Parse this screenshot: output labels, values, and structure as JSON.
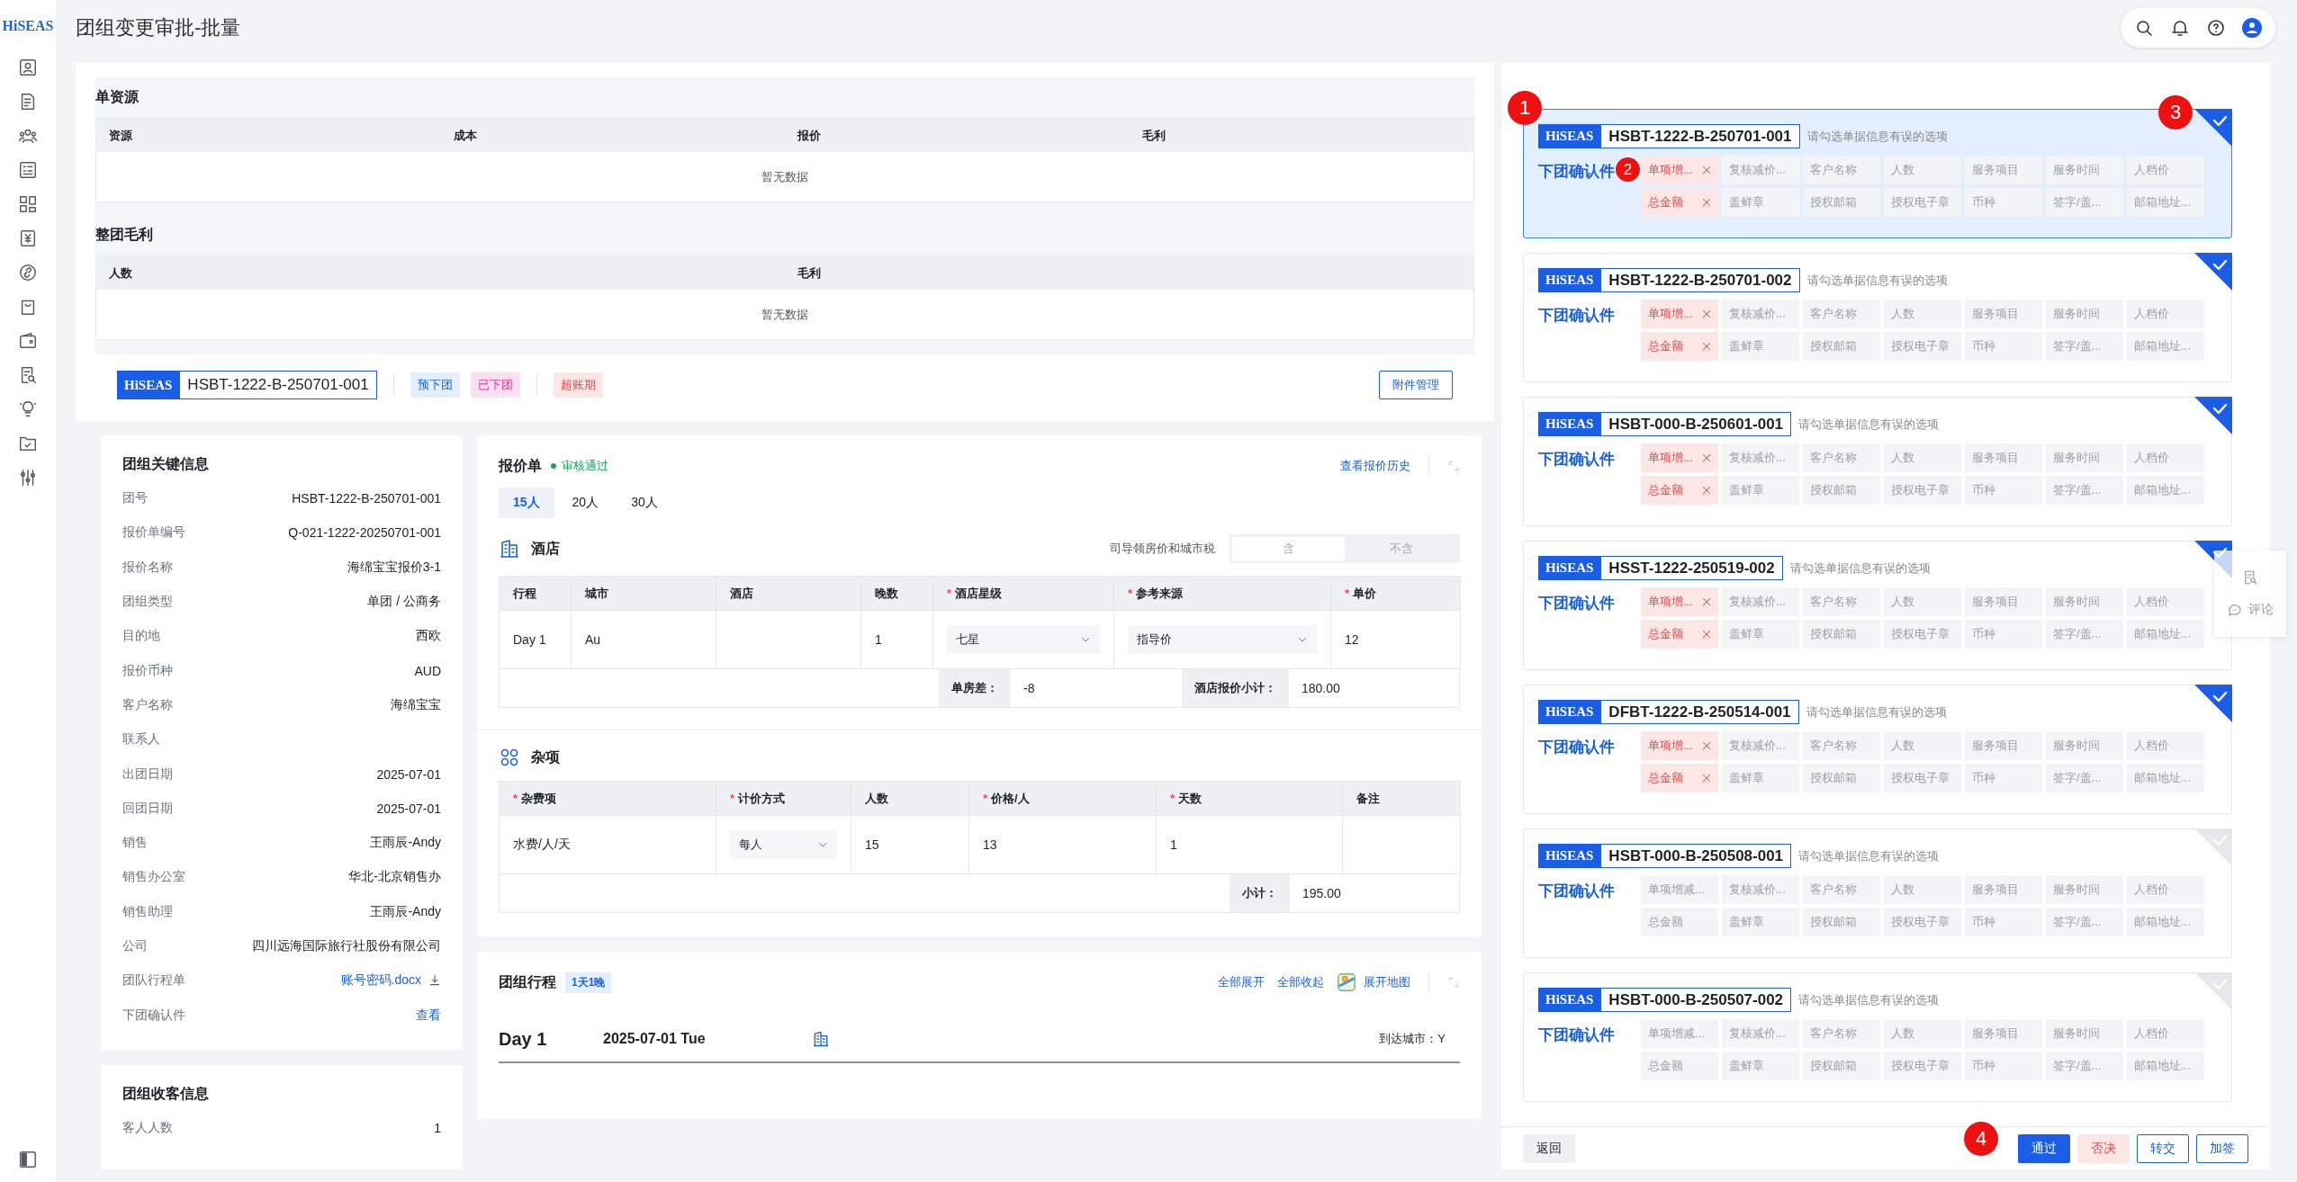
{
  "sidebar": {
    "logo": "HiSEAS"
  },
  "header": {
    "title": "团组变更审批-批量"
  },
  "single_resource": {
    "title": "单资源",
    "columns": [
      "资源",
      "成本",
      "报价",
      "毛利"
    ],
    "empty_text": "暂无数据"
  },
  "group_margin": {
    "title": "整团毛利",
    "columns": [
      "人数",
      "毛利"
    ],
    "empty_text": "暂无数据"
  },
  "group_bar": {
    "logo": "HiSEAS",
    "code": "HSBT-1222-B-250701-001",
    "status_tags": [
      {
        "text": "预下团",
        "kind": "pre"
      },
      {
        "text": "已下团",
        "kind": "done"
      }
    ],
    "alert_tags": [
      {
        "text": "超账期",
        "kind": "overdue"
      }
    ],
    "button": "附件管理"
  },
  "key_info": {
    "title": "团组关键信息",
    "rows": [
      {
        "label": "团号",
        "value": "HSBT-1222-B-250701-001",
        "kind": "text"
      },
      {
        "label": "报价单编号",
        "value": "Q-021-1222-20250701-001",
        "kind": "text"
      },
      {
        "label": "报价名称",
        "value": "海绵宝宝报价3-1",
        "kind": "text"
      },
      {
        "label": "团组类型",
        "value": "单团 / 公商务",
        "kind": "text"
      },
      {
        "label": "目的地",
        "value": "西欧",
        "kind": "text"
      },
      {
        "label": "报价币种",
        "value": "AUD",
        "kind": "text"
      },
      {
        "label": "客户名称",
        "value": "海绵宝宝",
        "kind": "text"
      },
      {
        "label": "联系人",
        "kind": "text"
      },
      {
        "label": "出团日期",
        "value": "2025-07-01",
        "kind": "text"
      },
      {
        "label": "回团日期",
        "value": "2025-07-01",
        "kind": "text"
      },
      {
        "label": "销售",
        "value": "王雨辰-Andy",
        "kind": "text"
      },
      {
        "label": "销售办公室",
        "value": "华北-北京销售办",
        "kind": "text"
      },
      {
        "label": "销售助理",
        "value": "王雨辰-Andy",
        "kind": "text"
      },
      {
        "label": "公司",
        "value": "四川远海国际旅行社股份有限公司",
        "kind": "text"
      },
      {
        "label": "团队行程单",
        "value": "账号密码.docx",
        "kind": "download"
      },
      {
        "label": "下团确认件",
        "value": "查看",
        "kind": "link"
      }
    ]
  },
  "guest_info": {
    "title": "团组收客信息",
    "rows": [
      {
        "label": "客人人数",
        "value": "1"
      }
    ]
  },
  "quote": {
    "title": "报价单",
    "status": "审核通过",
    "history_link": "查看报价历史",
    "tabs": [
      {
        "label": "15人",
        "selected": true
      },
      {
        "label": "20人",
        "selected": false
      },
      {
        "label": "30人",
        "selected": false
      }
    ],
    "hotel": {
      "title": "酒店",
      "tax_label": "司导领房价和城市税",
      "tax_options": [
        {
          "label": "含",
          "selected": true
        },
        {
          "label": "不含",
          "selected": false
        }
      ],
      "columns": [
        {
          "label": "行程"
        },
        {
          "label": "城市"
        },
        {
          "label": "酒店"
        },
        {
          "label": "晚数"
        },
        {
          "label": "酒店星级",
          "mark": "*"
        },
        {
          "label": "参考来源",
          "mark": "*"
        },
        {
          "label": "单价",
          "mark": "*"
        }
      ],
      "rows": [
        [
          {
            "kind": "text",
            "text": "Day 1"
          },
          {
            "kind": "text",
            "text": "Au"
          },
          {
            "kind": "empty"
          },
          {
            "kind": "text",
            "text": "1"
          },
          {
            "kind": "select",
            "text": "七星"
          },
          {
            "kind": "select",
            "text": "指导价"
          },
          {
            "kind": "text",
            "text": "12"
          }
        ]
      ],
      "summary": [
        {
          "label": "单房差：",
          "value": "-8"
        },
        {
          "label": "酒店报价小计：",
          "value": "180.00"
        }
      ]
    },
    "misc": {
      "title": "杂项",
      "columns": [
        {
          "label": "杂费项",
          "mark": "*"
        },
        {
          "label": "计价方式",
          "mark": "*"
        },
        {
          "label": "人数"
        },
        {
          "label": "价格/人",
          "mark": "*"
        },
        {
          "label": "天数",
          "mark": "*"
        },
        {
          "label": "备注"
        }
      ],
      "rows": [
        [
          {
            "kind": "text",
            "text": "水费/人/天"
          },
          {
            "kind": "select",
            "text": "每人"
          },
          {
            "kind": "text",
            "text": "15"
          },
          {
            "kind": "text",
            "text": "13"
          },
          {
            "kind": "text",
            "text": "1"
          },
          {
            "kind": "empty"
          }
        ]
      ],
      "summary": [
        {
          "label": "小计：",
          "value": "195.00"
        }
      ]
    }
  },
  "itinerary": {
    "title": "团组行程",
    "badge": "1天1晚",
    "links": [
      "全部展开",
      "全部收起"
    ],
    "map_link": "展开地图",
    "days": [
      {
        "day": "Day 1",
        "date": "2025-07-01 Tue",
        "arrival": "到达城市：Y"
      }
    ]
  },
  "approval_panel": {
    "cards": [
      {
        "logo": "HiSEAS",
        "code": "HSBT-1222-B-250701-001",
        "hint": "请勾选单据信息有误的选项",
        "doc_label": "下团确认件",
        "selected": true,
        "checked": true,
        "tags": [
          {
            "text": "单项增...",
            "flagged": true
          },
          {
            "text": "复核减价...",
            "flagged": false
          },
          {
            "text": "客户名称",
            "flagged": false
          },
          {
            "text": "人数",
            "flagged": false
          },
          {
            "text": "服务项目",
            "flagged": false
          },
          {
            "text": "服务时间",
            "flagged": false
          },
          {
            "text": "人档价",
            "flagged": false
          },
          {
            "text": "总金额",
            "flagged": true
          },
          {
            "text": "盖鲜章",
            "flagged": false
          },
          {
            "text": "授权邮箱",
            "flagged": false
          },
          {
            "text": "授权电子章",
            "flagged": false
          },
          {
            "text": "币种",
            "flagged": false
          },
          {
            "text": "签字/盖...",
            "flagged": false
          },
          {
            "text": "邮箱地址...",
            "flagged": false
          }
        ]
      },
      {
        "logo": "HiSEAS",
        "code": "HSBT-1222-B-250701-002",
        "hint": "请勾选单据信息有误的选项",
        "doc_label": "下团确认件",
        "selected": false,
        "checked": true,
        "tags": [
          {
            "text": "单项增...",
            "flagged": true
          },
          {
            "text": "复核减价...",
            "flagged": false
          },
          {
            "text": "客户名称",
            "flagged": false
          },
          {
            "text": "人数",
            "flagged": false
          },
          {
            "text": "服务项目",
            "flagged": false
          },
          {
            "text": "服务时间",
            "flagged": false
          },
          {
            "text": "人档价",
            "flagged": false
          },
          {
            "text": "总金额",
            "flagged": true
          },
          {
            "text": "盖鲜章",
            "flagged": false
          },
          {
            "text": "授权邮箱",
            "flagged": false
          },
          {
            "text": "授权电子章",
            "flagged": false
          },
          {
            "text": "币种",
            "flagged": false
          },
          {
            "text": "签字/盖...",
            "flagged": false
          },
          {
            "text": "邮箱地址...",
            "flagged": false
          }
        ]
      },
      {
        "logo": "HiSEAS",
        "code": "HSBT-000-B-250601-001",
        "hint": "请勾选单据信息有误的选项",
        "doc_label": "下团确认件",
        "selected": false,
        "checked": true,
        "tags": [
          {
            "text": "单项增...",
            "flagged": true
          },
          {
            "text": "复核减价...",
            "flagged": false
          },
          {
            "text": "客户名称",
            "flagged": false
          },
          {
            "text": "人数",
            "flagged": false
          },
          {
            "text": "服务项目",
            "flagged": false
          },
          {
            "text": "服务时间",
            "flagged": false
          },
          {
            "text": "人档价",
            "flagged": false
          },
          {
            "text": "总金额",
            "flagged": true
          },
          {
            "text": "盖鲜章",
            "flagged": false
          },
          {
            "text": "授权邮箱",
            "flagged": false
          },
          {
            "text": "授权电子章",
            "flagged": false
          },
          {
            "text": "币种",
            "flagged": false
          },
          {
            "text": "签字/盖...",
            "flagged": false
          },
          {
            "text": "邮箱地址...",
            "flagged": false
          }
        ]
      },
      {
        "logo": "HiSEAS",
        "code": "HSST-1222-250519-002",
        "hint": "请勾选单据信息有误的选项",
        "doc_label": "下团确认件",
        "selected": false,
        "checked": true,
        "tags": [
          {
            "text": "单项增...",
            "flagged": true
          },
          {
            "text": "复核减价...",
            "flagged": false
          },
          {
            "text": "客户名称",
            "flagged": false
          },
          {
            "text": "人数",
            "flagged": false
          },
          {
            "text": "服务项目",
            "flagged": false
          },
          {
            "text": "服务时间",
            "flagged": false
          },
          {
            "text": "人档价",
            "flagged": false
          },
          {
            "text": "总金额",
            "flagged": true
          },
          {
            "text": "盖鲜章",
            "flagged": false
          },
          {
            "text": "授权邮箱",
            "flagged": false
          },
          {
            "text": "授权电子章",
            "flagged": false
          },
          {
            "text": "币种",
            "flagged": false
          },
          {
            "text": "签字/盖...",
            "flagged": false
          },
          {
            "text": "邮箱地址...",
            "flagged": false
          }
        ]
      },
      {
        "logo": "HiSEAS",
        "code": "DFBT-1222-B-250514-001",
        "hint": "请勾选单据信息有误的选项",
        "doc_label": "下团确认件",
        "selected": false,
        "checked": true,
        "tags": [
          {
            "text": "单项增...",
            "flagged": true
          },
          {
            "text": "复核减价...",
            "flagged": false
          },
          {
            "text": "客户名称",
            "flagged": false
          },
          {
            "text": "人数",
            "flagged": false
          },
          {
            "text": "服务项目",
            "flagged": false
          },
          {
            "text": "服务时间",
            "flagged": false
          },
          {
            "text": "人档价",
            "flagged": false
          },
          {
            "text": "总金额",
            "flagged": true
          },
          {
            "text": "盖鲜章",
            "flagged": false
          },
          {
            "text": "授权邮箱",
            "flagged": false
          },
          {
            "text": "授权电子章",
            "flagged": false
          },
          {
            "text": "币种",
            "flagged": false
          },
          {
            "text": "签字/盖...",
            "flagged": false
          },
          {
            "text": "邮箱地址...",
            "flagged": false
          }
        ]
      },
      {
        "logo": "HiSEAS",
        "code": "HSBT-000-B-250508-001",
        "hint": "请勾选单据信息有误的选项",
        "doc_label": "下团确认件",
        "selected": false,
        "checked": false,
        "tags": [
          {
            "text": "单项增减...",
            "flagged": false
          },
          {
            "text": "复核减价...",
            "flagged": false
          },
          {
            "text": "客户名称",
            "flagged": false
          },
          {
            "text": "人数",
            "flagged": false
          },
          {
            "text": "服务项目",
            "flagged": false
          },
          {
            "text": "服务时间",
            "flagged": false
          },
          {
            "text": "人档价",
            "flagged": false
          },
          {
            "text": "总金额",
            "flagged": false
          },
          {
            "text": "盖鲜章",
            "flagged": false
          },
          {
            "text": "授权邮箱",
            "flagged": false
          },
          {
            "text": "授权电子章",
            "flagged": false
          },
          {
            "text": "币种",
            "flagged": false
          },
          {
            "text": "签字/盖...",
            "flagged": false
          },
          {
            "text": "邮箱地址...",
            "flagged": false
          }
        ]
      },
      {
        "logo": "HiSEAS",
        "code": "HSBT-000-B-250507-002",
        "hint": "请勾选单据信息有误的选项",
        "doc_label": "下团确认件",
        "selected": false,
        "checked": false,
        "tags": [
          {
            "text": "单项增减...",
            "flagged": false
          },
          {
            "text": "复核减价...",
            "flagged": false
          },
          {
            "text": "客户名称",
            "flagged": false
          },
          {
            "text": "人数",
            "flagged": false
          },
          {
            "text": "服务项目",
            "flagged": false
          },
          {
            "text": "服务时间",
            "flagged": false
          },
          {
            "text": "人档价",
            "flagged": false
          },
          {
            "text": "总金额",
            "flagged": false
          },
          {
            "text": "盖鲜章",
            "flagged": false
          },
          {
            "text": "授权邮箱",
            "flagged": false
          },
          {
            "text": "授权电子章",
            "flagged": false
          },
          {
            "text": "币种",
            "flagged": false
          },
          {
            "text": "签字/盖...",
            "flagged": false
          },
          {
            "text": "邮箱地址...",
            "flagged": false
          }
        ]
      }
    ],
    "footer": {
      "back": "返回",
      "actions": [
        {
          "label": "通过",
          "kind": "primary"
        },
        {
          "label": "否决",
          "kind": "danger"
        },
        {
          "label": "转交",
          "kind": "outline"
        },
        {
          "label": "加签",
          "kind": "outline"
        }
      ]
    },
    "side_widget": {
      "comment": "评论"
    }
  },
  "callouts": [
    {
      "number": "1"
    },
    {
      "number": "2"
    },
    {
      "number": "3"
    },
    {
      "number": "4"
    }
  ]
}
